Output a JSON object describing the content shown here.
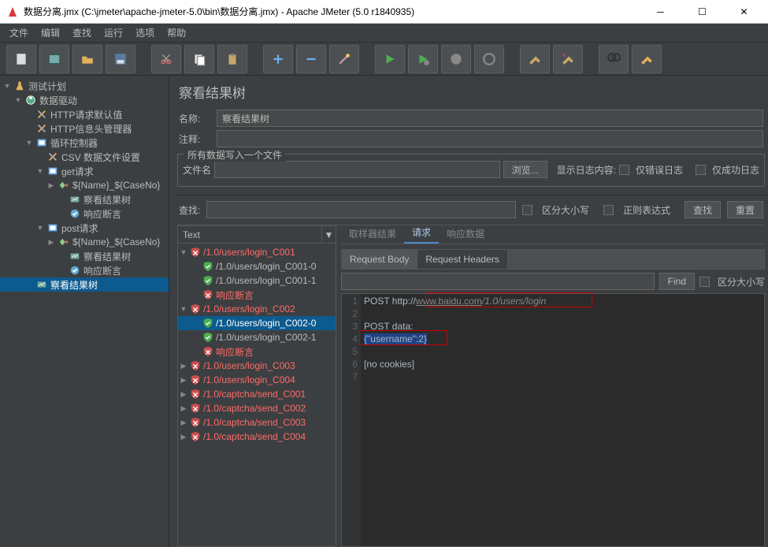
{
  "window": {
    "title": "数据分离.jmx (C:\\jmeter\\apache-jmeter-5.0\\bin\\数据分离.jmx) - Apache JMeter (5.0 r1840935)"
  },
  "menu": {
    "file": "文件",
    "edit": "编辑",
    "search": "查找",
    "run": "运行",
    "options": "选项",
    "help": "帮助"
  },
  "toolbar_icons": [
    "new-file",
    "templates",
    "open",
    "save",
    "",
    "cut",
    "copy",
    "paste",
    "",
    "add",
    "remove",
    "wand",
    "",
    "start",
    "start-remote",
    "stop",
    "shutdown",
    "",
    "clear",
    "clear-all",
    "",
    "search",
    "fn"
  ],
  "tree": [
    {
      "indent": 0,
      "toggle": "▼",
      "icon": "flask",
      "label": "测试计划"
    },
    {
      "indent": 1,
      "toggle": "▼",
      "icon": "threads",
      "label": "数据驱动"
    },
    {
      "indent": 2,
      "toggle": "",
      "icon": "config",
      "label": "HTTP请求默认值"
    },
    {
      "indent": 2,
      "toggle": "",
      "icon": "config",
      "label": "HTTP信息头管理器"
    },
    {
      "indent": 2,
      "toggle": "▼",
      "icon": "loop",
      "label": "循环控制器"
    },
    {
      "indent": 3,
      "toggle": "",
      "icon": "config",
      "label": "CSV 数据文件设置"
    },
    {
      "indent": 3,
      "toggle": "▼",
      "icon": "loop",
      "label": "get请求"
    },
    {
      "indent": 4,
      "toggle": "▶",
      "icon": "sampler",
      "label": "${Name}_${CaseNo}"
    },
    {
      "indent": 5,
      "toggle": "",
      "icon": "listener",
      "label": "察看结果树"
    },
    {
      "indent": 5,
      "toggle": "",
      "icon": "assertion",
      "label": "响应断言"
    },
    {
      "indent": 3,
      "toggle": "▼",
      "icon": "loop",
      "label": "post请求"
    },
    {
      "indent": 4,
      "toggle": "▶",
      "icon": "sampler",
      "label": "${Name}_${CaseNo}"
    },
    {
      "indent": 5,
      "toggle": "",
      "icon": "listener",
      "label": "察看结果树"
    },
    {
      "indent": 5,
      "toggle": "",
      "icon": "assertion",
      "label": "响应断言"
    },
    {
      "indent": 2,
      "toggle": "",
      "icon": "listener",
      "label": "察看结果树",
      "selected": true
    }
  ],
  "panel": {
    "heading": "察看结果树",
    "name_label": "名称:",
    "name_value": "察看结果树",
    "comment_label": "注释:",
    "comment_value": "",
    "fieldset_title": "所有数据写入一个文件",
    "filename_label": "文件名",
    "browse_btn": "浏览...",
    "log_display_label": "显示日志内容:",
    "errors_only": "仅错误日志",
    "success_only": "仅成功日志",
    "search_label": "查找:",
    "case_sensitive": "区分大小写",
    "regex": "正则表达式",
    "search_btn": "查找",
    "reset_btn": "重置"
  },
  "results_header": "Text",
  "results": [
    {
      "indent": 0,
      "toggle": "▼",
      "status": "fail",
      "label": "/1.0/users/login_C001"
    },
    {
      "indent": 1,
      "toggle": "",
      "status": "pass",
      "label": "/1.0/users/login_C001-0"
    },
    {
      "indent": 1,
      "toggle": "",
      "status": "pass",
      "label": "/1.0/users/login_C001-1"
    },
    {
      "indent": 1,
      "toggle": "",
      "status": "assert",
      "label": "响应断言"
    },
    {
      "indent": 0,
      "toggle": "▼",
      "status": "fail",
      "label": "/1.0/users/login_C002"
    },
    {
      "indent": 1,
      "toggle": "",
      "status": "pass",
      "label": "/1.0/users/login_C002-0",
      "selected": true
    },
    {
      "indent": 1,
      "toggle": "",
      "status": "pass",
      "label": "/1.0/users/login_C002-1"
    },
    {
      "indent": 1,
      "toggle": "",
      "status": "assert",
      "label": "响应断言"
    },
    {
      "indent": 0,
      "toggle": "▶",
      "status": "fail",
      "label": "/1.0/users/login_C003"
    },
    {
      "indent": 0,
      "toggle": "▶",
      "status": "fail",
      "label": "/1.0/users/login_C004"
    },
    {
      "indent": 0,
      "toggle": "▶",
      "status": "fail",
      "label": "/1.0/captcha/send_C001"
    },
    {
      "indent": 0,
      "toggle": "▶",
      "status": "fail",
      "label": "/1.0/captcha/send_C002"
    },
    {
      "indent": 0,
      "toggle": "▶",
      "status": "fail",
      "label": "/1.0/captcha/send_C003"
    },
    {
      "indent": 0,
      "toggle": "▶",
      "status": "fail",
      "label": "/1.0/captcha/send_C004"
    }
  ],
  "tabs": {
    "sampler_result": "取样器结果",
    "request": "请求",
    "response_data": "响应数据"
  },
  "subtabs": {
    "body": "Request Body",
    "headers": "Request Headers"
  },
  "find": {
    "btn": "Find",
    "case": "区分大小写"
  },
  "code": {
    "l1a": "POST http://",
    "l1b": "www.baidu.com",
    "l1c": "/1.0/users/login",
    "l2": "",
    "l3": "POST data:",
    "l4": "{\"username\":2}",
    "l5": "",
    "l6": "[no cookies]",
    "l7": ""
  }
}
